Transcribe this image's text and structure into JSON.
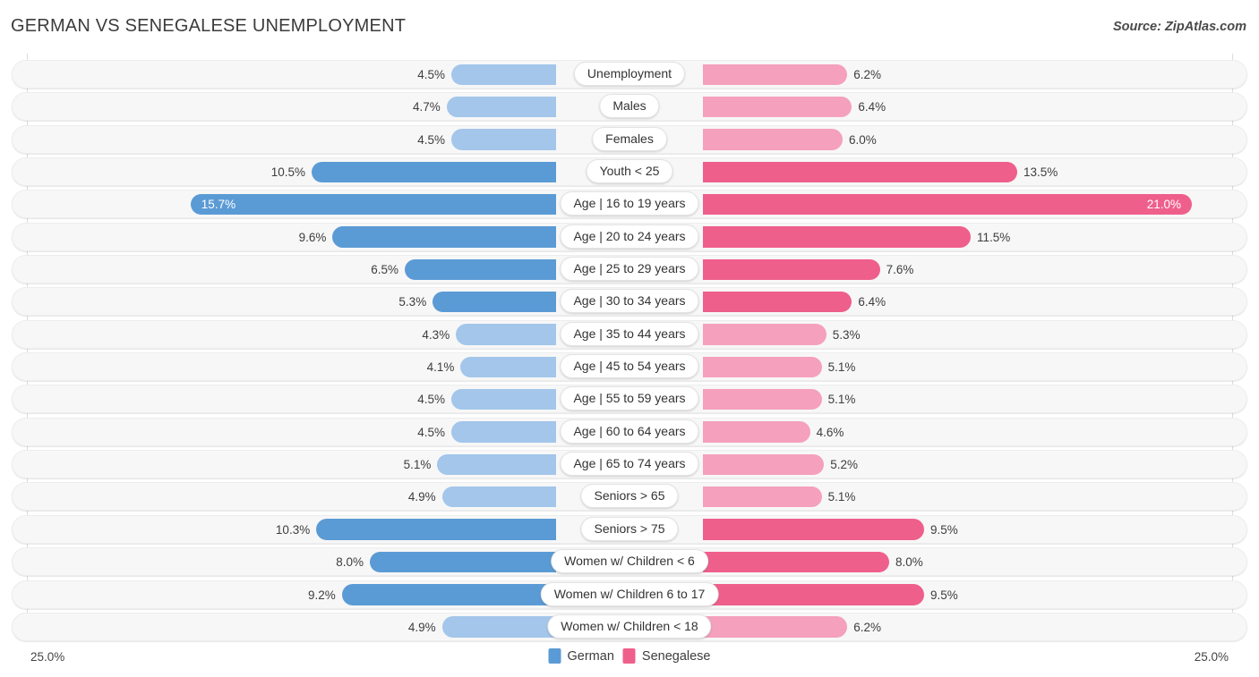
{
  "header": {
    "title": "GERMAN VS SENEGALESE UNEMPLOYMENT",
    "source": "Source: ZipAtlas.com"
  },
  "legend": {
    "items": [
      {
        "label": "German",
        "color": "#5b9bd5"
      },
      {
        "label": "Senegalese",
        "color": "#ef5f8c"
      }
    ]
  },
  "axis": {
    "left_label": "25.0%",
    "right_label": "25.0%",
    "max": 25.0
  },
  "colors": {
    "german_light": "#a3c6ea",
    "german_dark": "#5b9bd5",
    "senegalese_light": "#f5a0bd",
    "senegalese_dark": "#ef5f8c",
    "track": "#f7f7f7",
    "gridline": "#dcdcdc"
  },
  "chart_data": {
    "type": "bar",
    "subtype": "diverging-bidirectional",
    "title": "GERMAN VS SENEGALESE UNEMPLOYMENT",
    "xlabel": "",
    "ylabel": "",
    "xlim": [
      25.0,
      25.0
    ],
    "grid": true,
    "legend_position": "bottom-center",
    "unit": "%",
    "categories": [
      "Unemployment",
      "Males",
      "Females",
      "Youth < 25",
      "Age | 16 to 19 years",
      "Age | 20 to 24 years",
      "Age | 25 to 29 years",
      "Age | 30 to 34 years",
      "Age | 35 to 44 years",
      "Age | 45 to 54 years",
      "Age | 55 to 59 years",
      "Age | 60 to 64 years",
      "Age | 65 to 74 years",
      "Seniors > 65",
      "Seniors > 75",
      "Women w/ Children < 6",
      "Women w/ Children 6 to 17",
      "Women w/ Children < 18"
    ],
    "series": [
      {
        "name": "German",
        "side": "left",
        "values": [
          4.5,
          4.7,
          4.5,
          10.5,
          15.7,
          9.6,
          6.5,
          5.3,
          4.3,
          4.1,
          4.5,
          4.5,
          5.1,
          4.9,
          10.3,
          8.0,
          9.2,
          4.9
        ],
        "labels": [
          "4.5%",
          "4.7%",
          "4.5%",
          "10.5%",
          "15.7%",
          "9.6%",
          "6.5%",
          "5.3%",
          "4.3%",
          "4.1%",
          "4.5%",
          "4.5%",
          "5.1%",
          "4.9%",
          "10.3%",
          "8.0%",
          "9.2%",
          "4.9%"
        ]
      },
      {
        "name": "Senegalese",
        "side": "right",
        "values": [
          6.2,
          6.4,
          6.0,
          13.5,
          21.0,
          11.5,
          7.6,
          6.4,
          5.3,
          5.1,
          5.1,
          4.6,
          5.2,
          5.1,
          9.5,
          8.0,
          9.5,
          6.2
        ],
        "labels": [
          "6.2%",
          "6.4%",
          "6.0%",
          "13.5%",
          "21.0%",
          "11.5%",
          "7.6%",
          "6.4%",
          "5.3%",
          "5.1%",
          "5.1%",
          "4.6%",
          "5.2%",
          "5.1%",
          "9.5%",
          "8.0%",
          "9.5%",
          "6.2%"
        ]
      }
    ],
    "rows": [
      {
        "label": "Unemployment",
        "left": 4.5,
        "left_label": "4.5%",
        "right": 6.2,
        "right_label": "6.2%",
        "highlight": false
      },
      {
        "label": "Males",
        "left": 4.7,
        "left_label": "4.7%",
        "right": 6.4,
        "right_label": "6.4%",
        "highlight": false
      },
      {
        "label": "Females",
        "left": 4.5,
        "left_label": "4.5%",
        "right": 6.0,
        "right_label": "6.0%",
        "highlight": false
      },
      {
        "label": "Youth < 25",
        "left": 10.5,
        "left_label": "10.5%",
        "right": 13.5,
        "right_label": "13.5%",
        "highlight": true
      },
      {
        "label": "Age | 16 to 19 years",
        "left": 15.7,
        "left_label": "15.7%",
        "right": 21.0,
        "right_label": "21.0%",
        "highlight": true,
        "inside": true
      },
      {
        "label": "Age | 20 to 24 years",
        "left": 9.6,
        "left_label": "9.6%",
        "right": 11.5,
        "right_label": "11.5%",
        "highlight": true
      },
      {
        "label": "Age | 25 to 29 years",
        "left": 6.5,
        "left_label": "6.5%",
        "right": 7.6,
        "right_label": "7.6%",
        "highlight": true
      },
      {
        "label": "Age | 30 to 34 years",
        "left": 5.3,
        "left_label": "5.3%",
        "right": 6.4,
        "right_label": "6.4%",
        "highlight": true
      },
      {
        "label": "Age | 35 to 44 years",
        "left": 4.3,
        "left_label": "4.3%",
        "right": 5.3,
        "right_label": "5.3%",
        "highlight": false
      },
      {
        "label": "Age | 45 to 54 years",
        "left": 4.1,
        "left_label": "4.1%",
        "right": 5.1,
        "right_label": "5.1%",
        "highlight": false
      },
      {
        "label": "Age | 55 to 59 years",
        "left": 4.5,
        "left_label": "4.5%",
        "right": 5.1,
        "right_label": "5.1%",
        "highlight": false
      },
      {
        "label": "Age | 60 to 64 years",
        "left": 4.5,
        "left_label": "4.5%",
        "right": 4.6,
        "right_label": "4.6%",
        "highlight": false
      },
      {
        "label": "Age | 65 to 74 years",
        "left": 5.1,
        "left_label": "5.1%",
        "right": 5.2,
        "right_label": "5.2%",
        "highlight": false
      },
      {
        "label": "Seniors > 65",
        "left": 4.9,
        "left_label": "4.9%",
        "right": 5.1,
        "right_label": "5.1%",
        "highlight": false
      },
      {
        "label": "Seniors > 75",
        "left": 10.3,
        "left_label": "10.3%",
        "right": 9.5,
        "right_label": "9.5%",
        "highlight": true
      },
      {
        "label": "Women w/ Children < 6",
        "left": 8.0,
        "left_label": "8.0%",
        "right": 8.0,
        "right_label": "8.0%",
        "highlight": true
      },
      {
        "label": "Women w/ Children 6 to 17",
        "left": 9.2,
        "left_label": "9.2%",
        "right": 9.5,
        "right_label": "9.5%",
        "highlight": true
      },
      {
        "label": "Women w/ Children < 18",
        "left": 4.9,
        "left_label": "4.9%",
        "right": 6.2,
        "right_label": "6.2%",
        "highlight": false
      }
    ]
  }
}
